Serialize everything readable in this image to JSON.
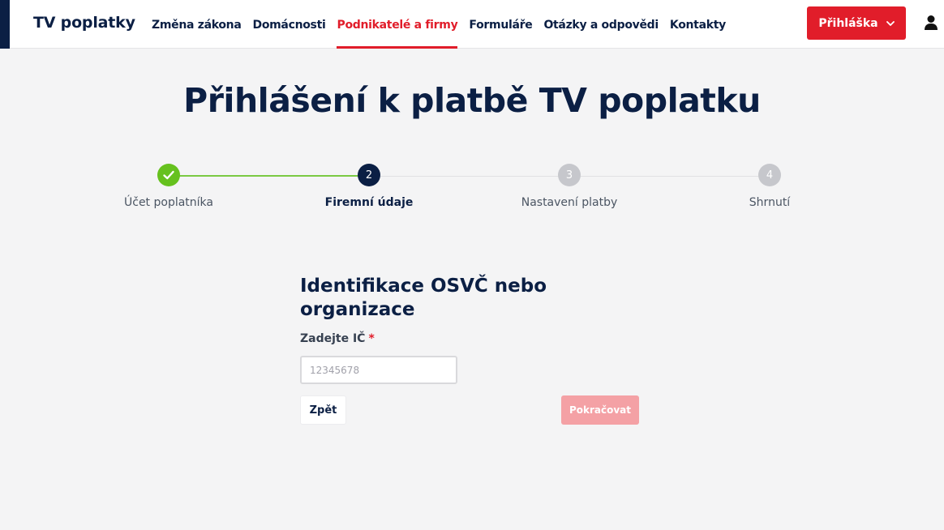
{
  "header": {
    "logo": "TV poplatky",
    "nav": [
      {
        "label": "Změna zákona",
        "active": false
      },
      {
        "label": "Domácnosti",
        "active": false
      },
      {
        "label": "Podnikatelé a firmy",
        "active": true
      },
      {
        "label": "Formuláře",
        "active": false
      },
      {
        "label": "Otázky a odpovědi",
        "active": false
      },
      {
        "label": "Kontakty",
        "active": false
      }
    ],
    "login_button": "Přihláška",
    "icons": {
      "chevron": "chevron-down-icon",
      "user": "user-icon"
    }
  },
  "page": {
    "title": "Přihlášení k platbě TV poplatku"
  },
  "stepper": {
    "steps": [
      {
        "number": "1",
        "label": "Účet poplatníka",
        "state": "done"
      },
      {
        "number": "2",
        "label": "Firemní údaje",
        "state": "current"
      },
      {
        "number": "3",
        "label": "Nastavení platby",
        "state": "todo"
      },
      {
        "number": "4",
        "label": "Shrnutí",
        "state": "todo"
      }
    ],
    "icons": {
      "done": "check-icon"
    }
  },
  "form": {
    "section_title": "Identifikace OSVČ nebo organizace",
    "ic_label": "Zadejte IČ",
    "required_mark": "*",
    "ic_placeholder": "12345678",
    "ic_value": "",
    "back_button": "Zpět",
    "continue_button": "Pokračovat"
  },
  "colors": {
    "brand_navy": "#0b1f44",
    "accent_red": "#e11d2a",
    "success_green": "#66c11e",
    "disabled_red": "#f4a1a5"
  }
}
